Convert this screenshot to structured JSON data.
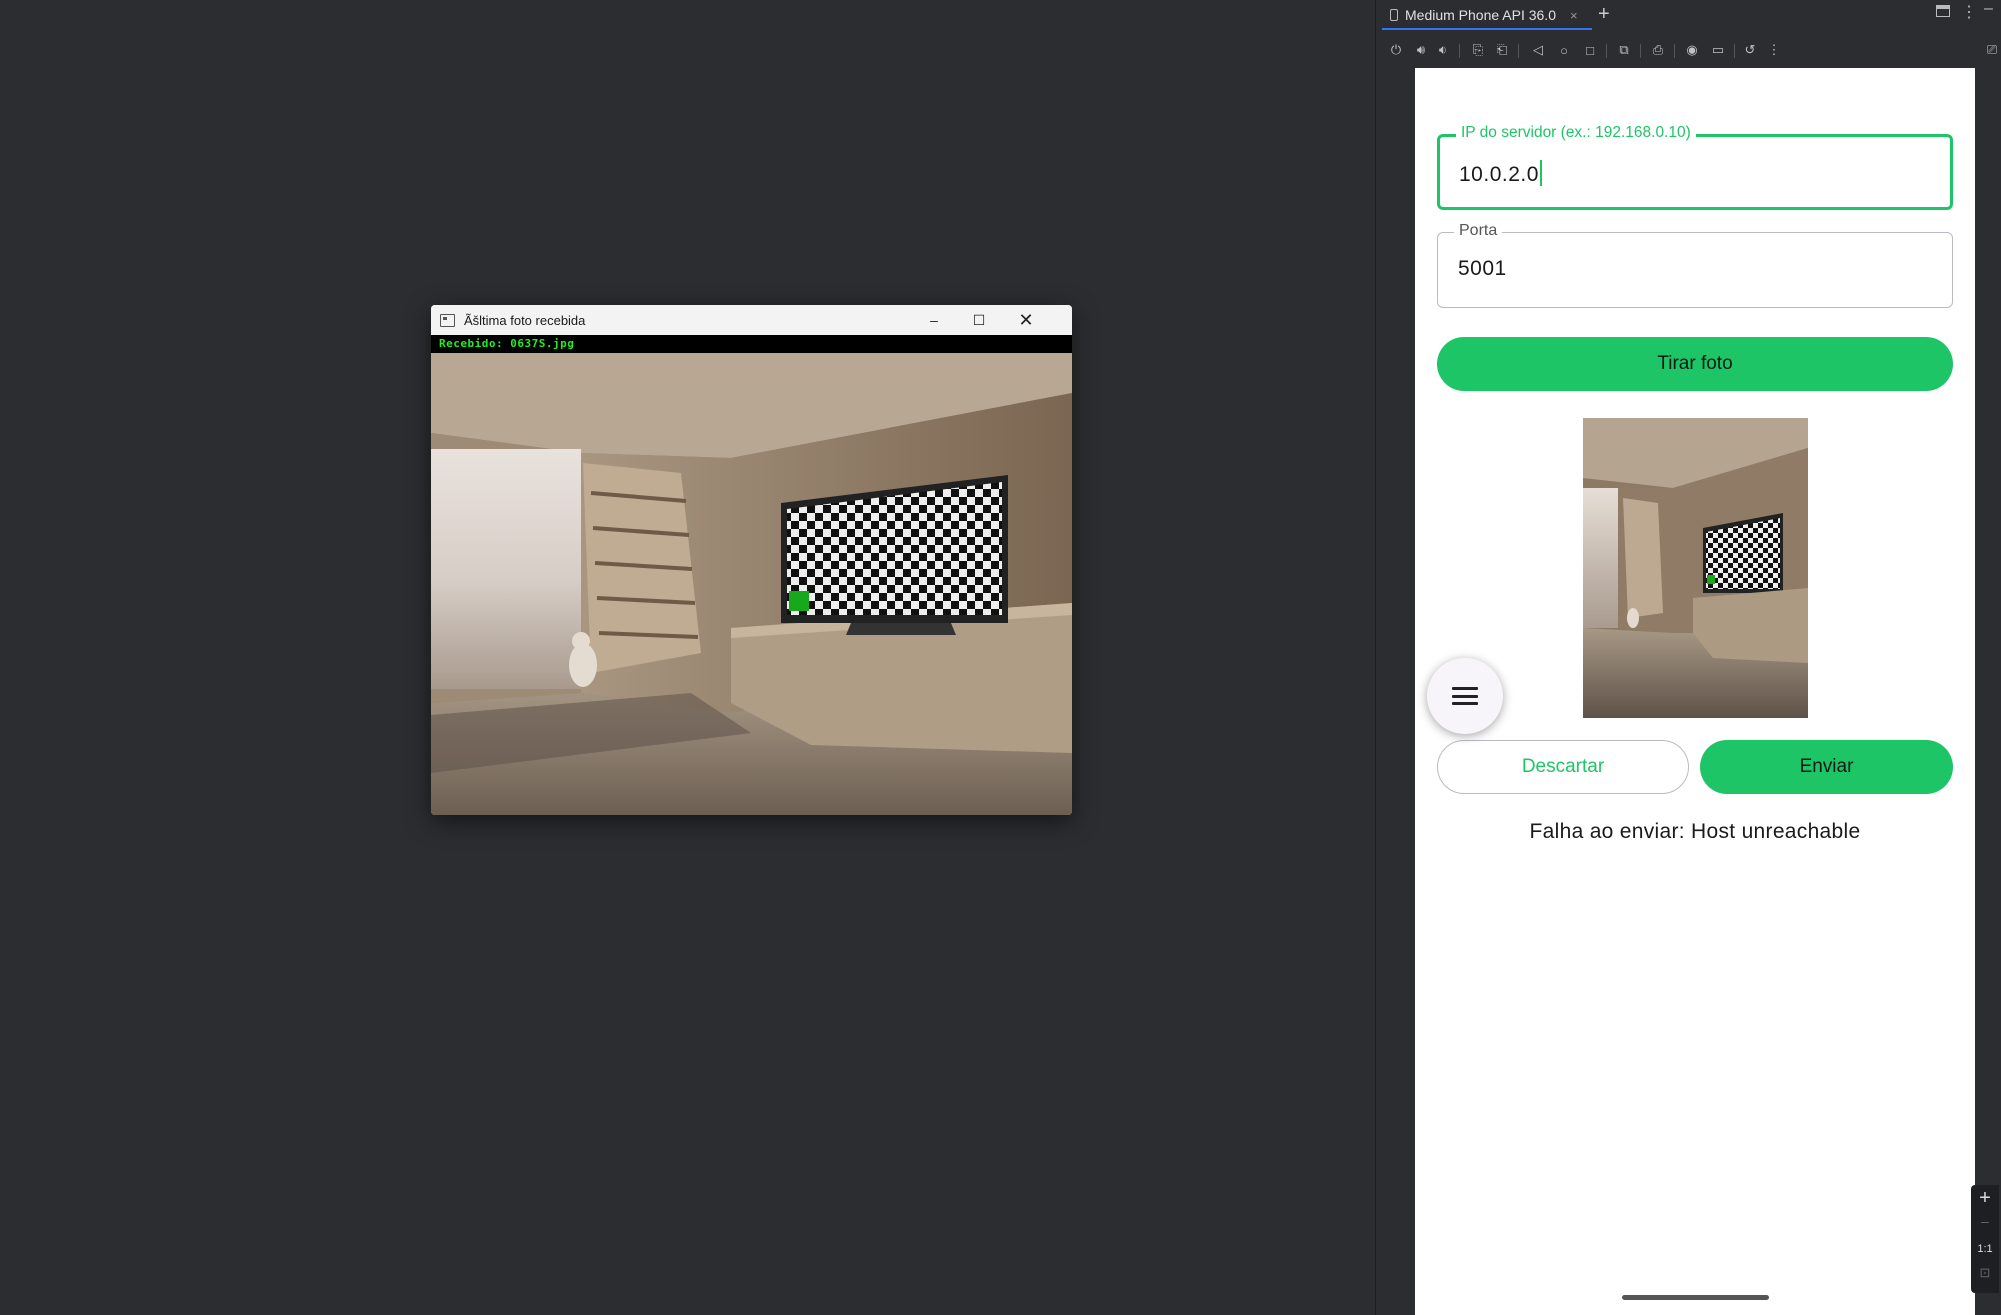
{
  "viewer": {
    "title": "Ãšltima foto recebida",
    "caption": "Recebido: 0637S.jpg",
    "minimize": "–",
    "maximize": "☐",
    "close": "✕"
  },
  "emulator": {
    "tab_label": "Medium Phone API 36.0",
    "tab_close": "×",
    "add_tab": "+",
    "toolbar_icons": [
      "power-icon",
      "volume-up-icon",
      "volume-down-icon",
      "rotate-left-icon",
      "rotate-right-icon",
      "back-icon",
      "home-icon",
      "overview-icon",
      "screenshot-icon",
      "snapshot-icon",
      "camera-icon",
      "record-icon",
      "reset-icon",
      "more-icon"
    ],
    "zoom_in": "+",
    "zoom_ratio": "1:1"
  },
  "app": {
    "ip_label": "IP do servidor (ex.: 192.168.0.10)",
    "ip_value": "10.0.2.0",
    "port_label": "Porta",
    "port_value": "5001",
    "take_photo": "Tirar foto",
    "discard": "Descartar",
    "send": "Enviar",
    "status": "Falha ao enviar: Host unreachable"
  },
  "colors": {
    "accent": "#1ec567",
    "ide_bg": "#2b2d30",
    "caption_green": "#22ee22"
  }
}
